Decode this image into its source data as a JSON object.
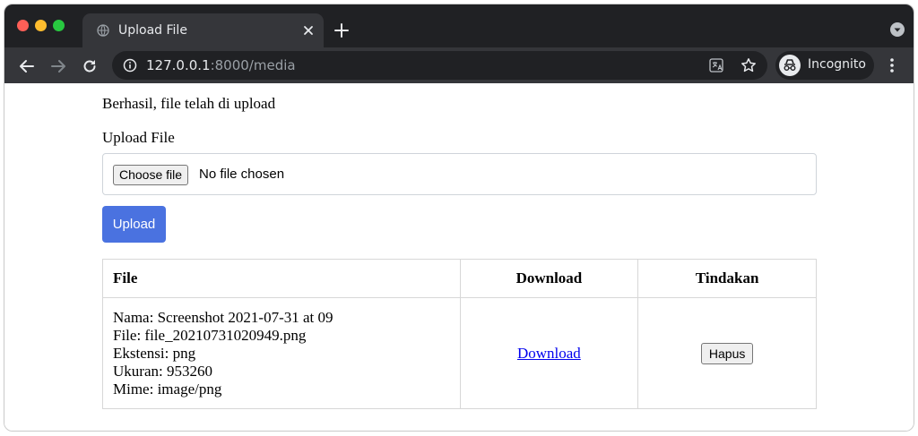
{
  "browser": {
    "tab_title": "Upload File",
    "url_host": "127.0.0.1",
    "url_rest": ":8000/media",
    "profile_label": "Incognito"
  },
  "page": {
    "success_message": "Berhasil, file telah di upload",
    "upload_label": "Upload File",
    "file_input": {
      "button_label": "Choose file",
      "status_text": "No file chosen"
    },
    "upload_button_label": "Upload",
    "table": {
      "headers": [
        "File",
        "Download",
        "Tindakan"
      ],
      "rows": [
        {
          "nama": "Nama: Screenshot 2021-07-31 at 09",
          "file": "File: file_20210731020949.png",
          "ekstensi": "Ekstensi: png",
          "ukuran": "Ukuran: 953260",
          "mime": "Mime: image/png",
          "download_label": "Download",
          "action_label": "Hapus"
        }
      ]
    }
  },
  "colors": {
    "accent_button": "#4a72e0",
    "link": "#0000ee",
    "chrome_dark": "#202124",
    "chrome_toolbar": "#35363a"
  },
  "icons": [
    "globe-icon",
    "close-icon",
    "plus-icon",
    "tab-search-icon",
    "back-icon",
    "forward-icon",
    "reload-icon",
    "info-icon",
    "translate-icon",
    "star-icon",
    "incognito-icon",
    "kebab-menu-icon"
  ]
}
